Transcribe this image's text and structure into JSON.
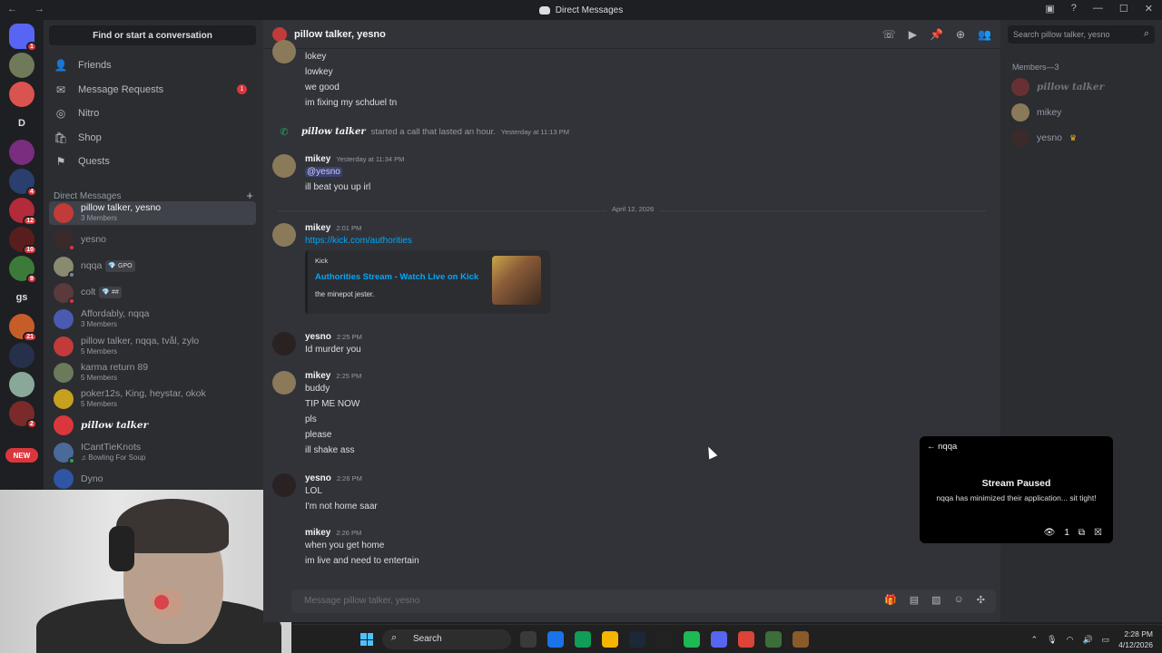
{
  "window": {
    "title": "Direct Messages"
  },
  "guilds": [
    {
      "label": "",
      "color": "#5865f2",
      "badge": "1",
      "home": true
    },
    {
      "label": "",
      "color": "#6f7a5a",
      "badge": ""
    },
    {
      "label": "",
      "color": "#d9534f",
      "badge": ""
    },
    {
      "label": "D",
      "color": "#1e1f22",
      "badge": ""
    },
    {
      "label": "",
      "color": "#7a2d7f",
      "badge": ""
    },
    {
      "label": "",
      "color": "#2a3f6e",
      "badge": "4"
    },
    {
      "label": "",
      "color": "#b32b3a",
      "badge": "12"
    },
    {
      "label": "",
      "color": "#5a1d1d",
      "badge": "10"
    },
    {
      "label": "",
      "color": "#3c7a3a",
      "badge": "9"
    },
    {
      "label": "gs",
      "color": "#1e1f22",
      "badge": ""
    },
    {
      "label": "",
      "color": "#c65d28",
      "badge": "21"
    },
    {
      "label": "",
      "color": "#27304a",
      "badge": ""
    },
    {
      "label": "",
      "color": "#8aa89a",
      "badge": ""
    },
    {
      "label": "",
      "color": "#7a2a2a",
      "badge": "2"
    },
    {
      "label": "",
      "color": "#1e1f22",
      "badge": "2"
    }
  ],
  "new_badge": "NEW",
  "sidebar": {
    "search_label": "Find or start a conversation",
    "nav": [
      {
        "label": "Friends",
        "icon": "friends-icon"
      },
      {
        "label": "Message Requests",
        "icon": "mail-icon",
        "badge": "1"
      },
      {
        "label": "Nitro",
        "icon": "nitro-icon"
      },
      {
        "label": "Shop",
        "icon": "shop-icon"
      },
      {
        "label": "Quests",
        "icon": "quests-icon"
      }
    ],
    "dm_header": "Direct Messages",
    "dms": [
      {
        "name": "pillow talker, yesno",
        "sub": "3 Members",
        "color": "#c23a3a",
        "active": true
      },
      {
        "name": "yesno",
        "sub": "",
        "color": "#3a2a2a",
        "status": "#da373c"
      },
      {
        "name": "nqqa",
        "sub": "",
        "color": "#8a8a70",
        "tag": "💎 GPO",
        "status": "#80848e"
      },
      {
        "name": "colt",
        "sub": "",
        "color": "#5a3a3a",
        "tag": "💎 ##",
        "status": "#da373c"
      },
      {
        "name": "Affordably, nqqa",
        "sub": "3 Members",
        "color": "#4a5ab0"
      },
      {
        "name": "pillow talker, nqqa, tvål, zylo",
        "sub": "5 Members",
        "color": "#c23a3a"
      },
      {
        "name": "karma return 89",
        "sub": "5 Members",
        "color": "#6a7a5a"
      },
      {
        "name": "poker12s, King, heystar, okok",
        "sub": "5 Members",
        "color": "#c8a020"
      },
      {
        "name": "pillow talker",
        "sub": "",
        "color": "#da373c",
        "fancy": true
      },
      {
        "name": "ICantTieKnots",
        "sub": "♫ Bowling For Soup",
        "color": "#4a6a9a",
        "status": "#23a55a"
      },
      {
        "name": "Dyno",
        "sub": "",
        "color": "#2f55a4"
      }
    ]
  },
  "chat": {
    "title": "pillow talker, yesno",
    "composer_placeholder": "Message pillow talker, yesno",
    "lines_top": [
      "lokey",
      "lowkey",
      "we good",
      "im fixing my schduel tn"
    ],
    "call": {
      "who": "pillow talker",
      "text": "started a call that lasted an hour.",
      "time": "Yesterday at 11:13 PM"
    },
    "m1": {
      "author": "mikey",
      "time": "Yesterday at 11:34 PM",
      "mention": "@yesno",
      "text": "ill beat you up irl"
    },
    "date_divider": "April 12, 2026",
    "m2": {
      "author": "mikey",
      "time": "2:01 PM",
      "link": "https://kick.com/authorities"
    },
    "embed": {
      "provider": "Kick",
      "title": "Authorities Stream - Watch Live on Kick",
      "desc": "the minepot jester."
    },
    "m3": {
      "author": "yesno",
      "time": "2:25 PM",
      "lines": [
        "Id murder you"
      ]
    },
    "m4": {
      "author": "mikey",
      "time": "2:25 PM",
      "lines": [
        "buddy",
        "TIP ME NOW",
        "pls",
        "please",
        "ill shake ass"
      ]
    },
    "m5": {
      "author": "yesno",
      "time": "2:26 PM",
      "lines": [
        "LOL",
        "I'm not home saar"
      ]
    },
    "m6": {
      "author": "mikey",
      "time": "2:26 PM",
      "lines": [
        "when you get home",
        "im live and need to entertain"
      ]
    }
  },
  "members": {
    "search_placeholder": "Search pillow talker, yesno",
    "header": "Members—3",
    "list": [
      {
        "name": "pillow talker",
        "color": "#da373c",
        "offline": true
      },
      {
        "name": "mikey",
        "color": "#8a7a5a"
      },
      {
        "name": "yesno",
        "color": "#3a2a2a",
        "crown": "♛"
      }
    ]
  },
  "stream_popup": {
    "back_label": "← nqqa",
    "title": "Stream Paused",
    "desc": "nqqa has minimized their application... sit tight!",
    "viewers": "1"
  },
  "taskbar": {
    "search": "Search",
    "time": "2:28 PM",
    "date": "4/12/2026",
    "apps": [
      "#3a3a3a",
      "#1a73e8",
      "#0f9d58",
      "#f4b400",
      "#1b2838",
      "#222",
      "#1db954",
      "#5865f2",
      "#db4437",
      "#3c6e3a",
      "#8a5a2a"
    ]
  }
}
